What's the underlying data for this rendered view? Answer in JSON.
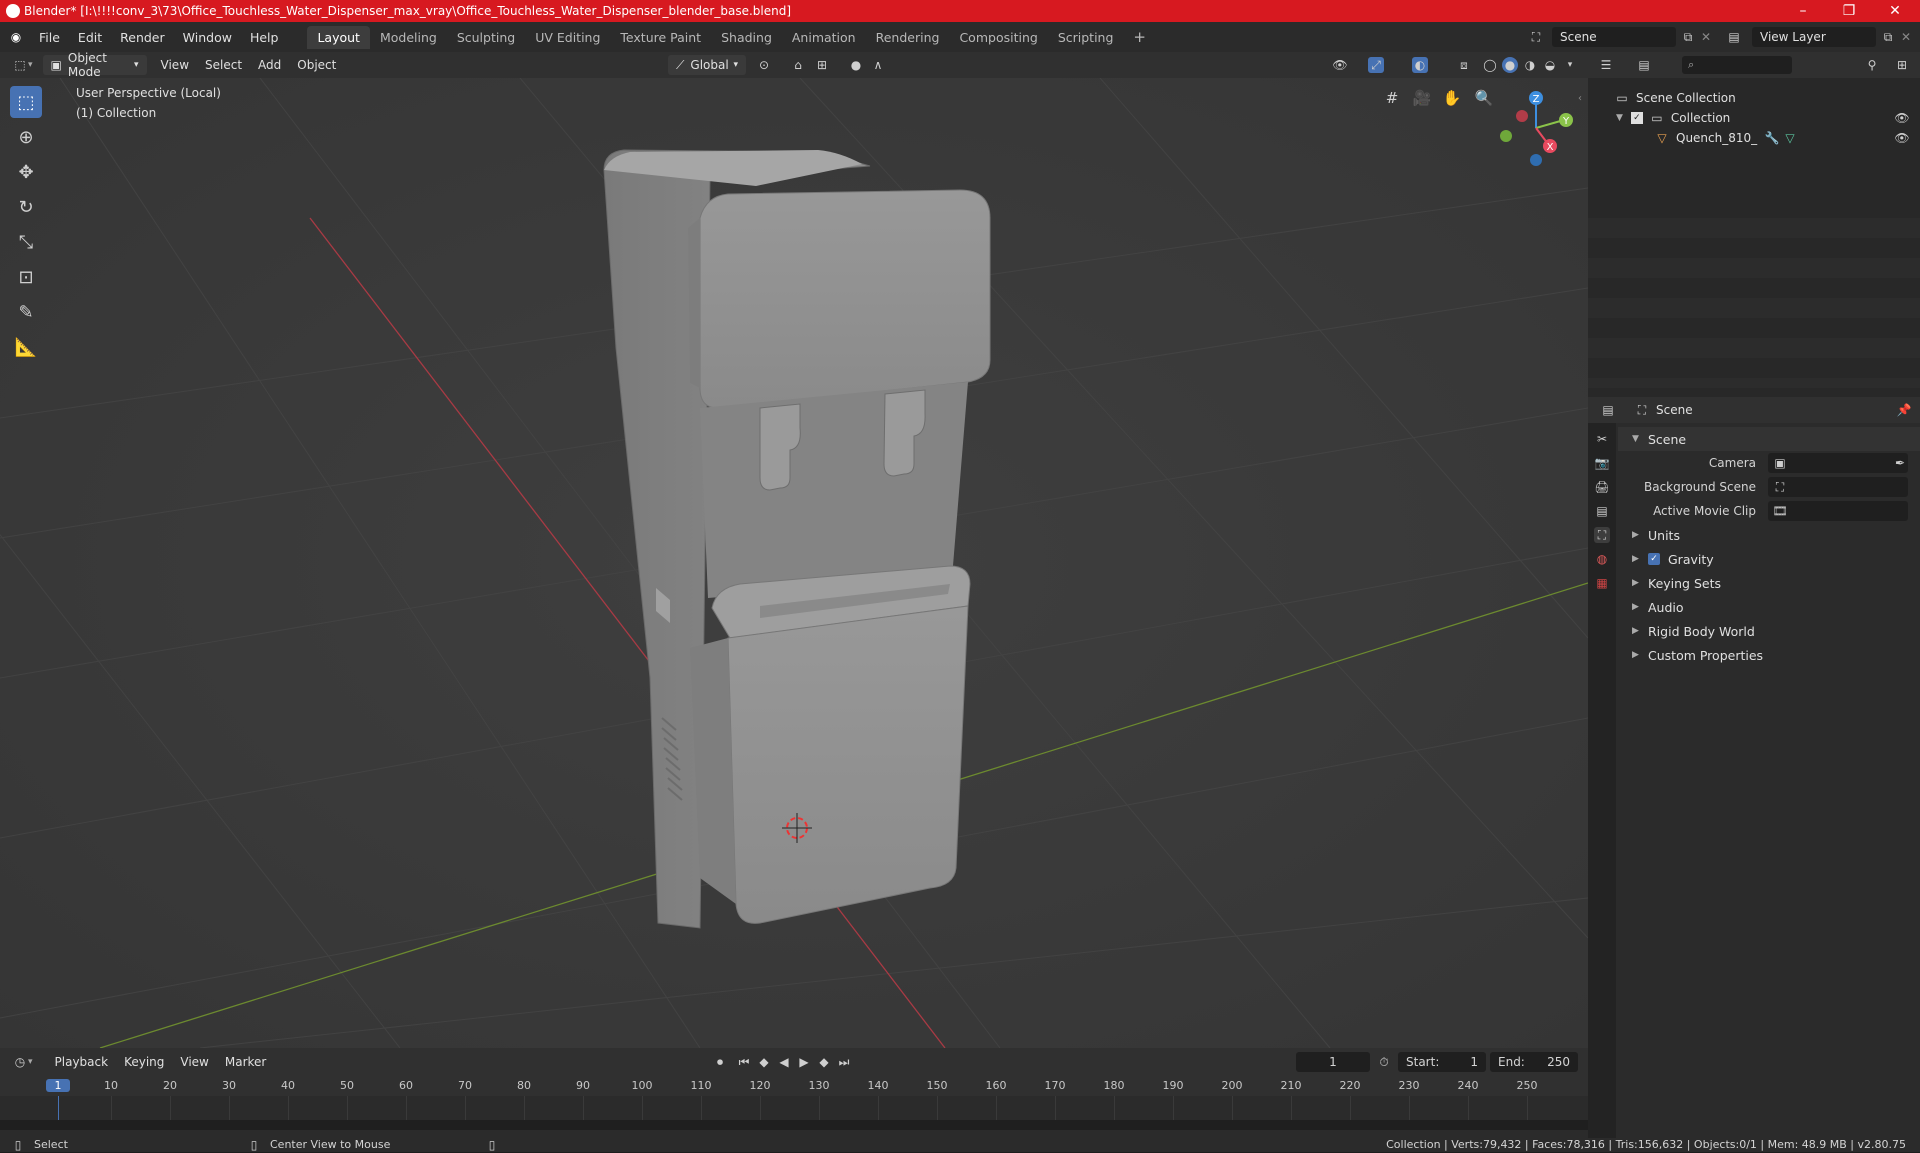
{
  "window": {
    "title": "Blender* [I:\\!!!!conv_3\\73\\Office_Touchless_Water_Dispenser_max_vray\\Office_Touchless_Water_Dispenser_blender_base.blend]",
    "minimize": "–",
    "maximize": "❐",
    "close": "✕"
  },
  "menu": {
    "items": [
      "File",
      "Edit",
      "Render",
      "Window",
      "Help"
    ],
    "workspaces": [
      "Layout",
      "Modeling",
      "Sculpting",
      "UV Editing",
      "Texture Paint",
      "Shading",
      "Animation",
      "Rendering",
      "Compositing",
      "Scripting"
    ],
    "add_tab": "+",
    "scene_name": "Scene",
    "view_layer": "View Layer"
  },
  "viewport_header": {
    "mode": "Object Mode",
    "menus": [
      "View",
      "Select",
      "Add",
      "Object"
    ],
    "orientation": "Global"
  },
  "viewport": {
    "perspective": "User Perspective (Local)",
    "collection": "(1) Collection",
    "gizmo": {
      "z": "Z",
      "y": "Y",
      "x": "X"
    }
  },
  "outliner": {
    "search_placeholder": "",
    "root": "Scene Collection",
    "collection": "Collection",
    "object": "Quench_810_"
  },
  "properties": {
    "header": "Scene",
    "panel_title": "Scene",
    "camera_label": "Camera",
    "background_label": "Background Scene",
    "movieclip_label": "Active Movie Clip",
    "panels": [
      "Units",
      "Gravity",
      "Keying Sets",
      "Audio",
      "Rigid Body World",
      "Custom Properties"
    ]
  },
  "timeline": {
    "menus": [
      "Playback",
      "Keying",
      "View",
      "Marker"
    ],
    "current_frame": "1",
    "start_label": "Start:",
    "start": "1",
    "end_label": "End:",
    "end": "250",
    "ticks": [
      "1",
      "10",
      "20",
      "30",
      "40",
      "50",
      "60",
      "70",
      "80",
      "90",
      "100",
      "110",
      "120",
      "130",
      "140",
      "150",
      "160",
      "170",
      "180",
      "190",
      "200",
      "210",
      "220",
      "230",
      "240",
      "250"
    ]
  },
  "statusbar": {
    "select": "Select",
    "center": "Center View to Mouse",
    "stats": "Collection | Verts:79,432 | Faces:78,316 | Tris:156,632 | Objects:0/1 | Mem: 48.9 MB | v2.80.75"
  },
  "colors": {
    "title_bar": "#d71920",
    "accent": "#4772b3",
    "x_axis": "#e84a5f",
    "y_axis": "#8bc34a",
    "z_axis": "#3d8fe0"
  }
}
